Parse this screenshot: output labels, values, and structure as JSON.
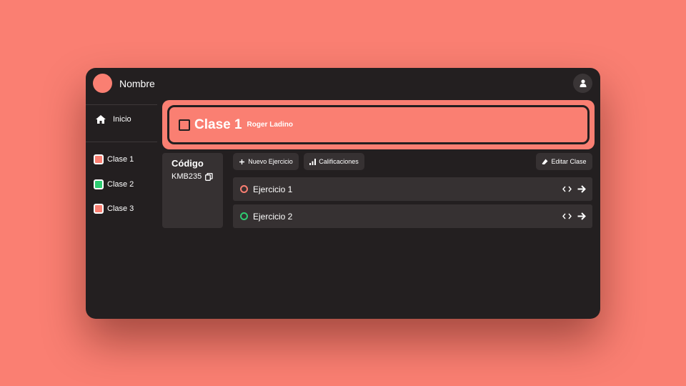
{
  "app": {
    "title": "Nombre",
    "accent": "#fa7f72",
    "bg": "#231f20",
    "panel": "#363132"
  },
  "sidebar": {
    "home": {
      "label": "Inicio",
      "icon": "home-icon"
    },
    "classes": [
      {
        "label": "Clase 1",
        "color": "#fa7f72"
      },
      {
        "label": "Clase 2",
        "color": "#2ecc71"
      },
      {
        "label": "Clase 3",
        "color": "#fa7f72"
      }
    ]
  },
  "banner": {
    "title": "Clase 1",
    "teacher": "Roger Ladino"
  },
  "code": {
    "title": "Código",
    "value": "KMB235"
  },
  "toolbar": {
    "new_exercise": "Nuevo Ejercicio",
    "grades": "Calificaciones",
    "edit_class": "Editar Clase"
  },
  "exercises": [
    {
      "label": "Ejercicio 1",
      "status_color": "#fa7f72"
    },
    {
      "label": "Ejercicio 2",
      "status_color": "#2ecc71"
    }
  ]
}
